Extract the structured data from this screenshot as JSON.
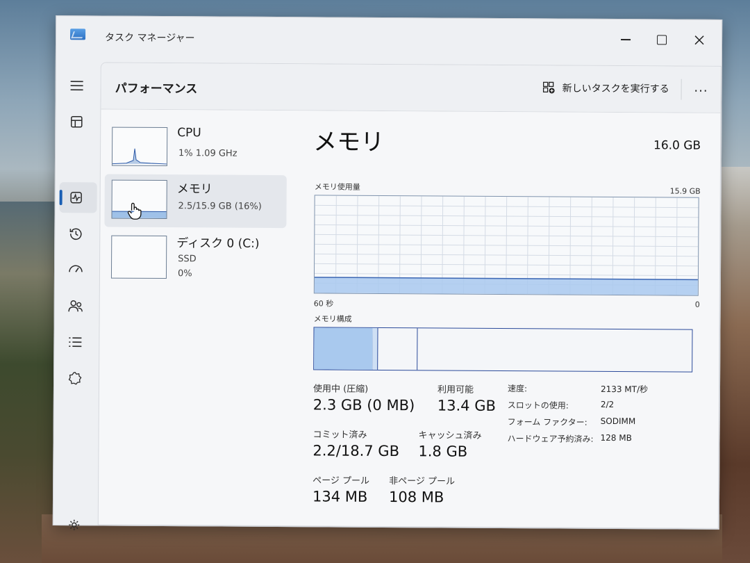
{
  "window": {
    "title": "タスク マネージャー",
    "accent_color": "#1a5fb4"
  },
  "nav": {
    "items": [
      "hamburger-icon",
      "processes-icon",
      "performance-icon",
      "app-history-icon",
      "startup-icon",
      "users-icon",
      "details-icon",
      "services-icon"
    ],
    "selected": "performance-icon",
    "bottom": "settings-icon"
  },
  "header": {
    "title": "パフォーマンス",
    "run_new_task": "新しいタスクを実行する",
    "more": "..."
  },
  "sidebar": {
    "items": [
      {
        "name": "CPU",
        "line1": "1%  1.09 GHz",
        "line2": ""
      },
      {
        "name": "メモリ",
        "line1": "2.5/15.9 GB (16%)",
        "line2": ""
      },
      {
        "name": "ディスク 0 (C:)",
        "line1": "SSD",
        "line2": "0%"
      }
    ]
  },
  "memory": {
    "title": "メモリ",
    "total": "16.0 GB",
    "usage_label": "メモリ使用量",
    "usage_max": "15.9 GB",
    "usage_fraction": 0.16,
    "time_left": "60 秒",
    "time_right": "0",
    "composition_label": "メモリ構成",
    "composition": {
      "in_use_fraction": 0.155,
      "modified_fraction": 0.012,
      "standby_fraction": 0.105
    },
    "stats": {
      "in_use_label": "使用中 (圧縮)",
      "in_use_value": "2.3 GB (0 MB)",
      "available_label": "利用可能",
      "available_value": "13.4 GB",
      "committed_label": "コミット済み",
      "committed_value": "2.2/18.7 GB",
      "cached_label": "キャッシュ済み",
      "cached_value": "1.8 GB",
      "paged_label": "ページ プール",
      "paged_value": "134 MB",
      "nonpaged_label": "非ページ プール",
      "nonpaged_value": "108 MB"
    },
    "specs": {
      "speed_label": "速度:",
      "speed_value": "2133 MT/秒",
      "slots_label": "スロットの使用:",
      "slots_value": "2/2",
      "form_label": "フォーム ファクター:",
      "form_value": "SODIMM",
      "reserved_label": "ハードウェア予約済み:",
      "reserved_value": "128 MB"
    }
  }
}
